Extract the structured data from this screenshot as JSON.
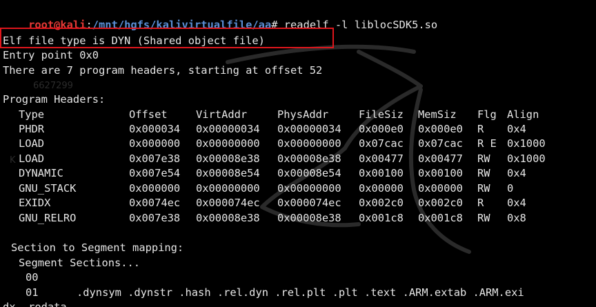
{
  "prompt": {
    "user_host": "root@kali",
    "separator": ":",
    "path": "/mnt/hgfs/kalivirtualfile/aa",
    "symbol": "#",
    "command": " readelf -l liblocSDK5.so"
  },
  "header": {
    "file_type": "Elf file type is DYN (Shared object file)",
    "entry_point": "Entry point 0x0",
    "program_headers_count": "There are 7 program headers, starting at offset 52"
  },
  "program_headers": {
    "title": "Program Headers:",
    "columns": [
      "Type",
      "Offset",
      "VirtAddr",
      "PhysAddr",
      "FileSiz",
      "MemSiz",
      "Flg",
      "Align"
    ],
    "rows": [
      [
        "PHDR",
        "0x000034",
        "0x00000034",
        "0x00000034",
        "0x000e0",
        "0x000e0",
        "R",
        "0x4"
      ],
      [
        "LOAD",
        "0x000000",
        "0x00000000",
        "0x00000000",
        "0x07cac",
        "0x07cac",
        "R E",
        "0x1000"
      ],
      [
        "LOAD",
        "0x007e38",
        "0x00008e38",
        "0x00008e38",
        "0x00477",
        "0x00477",
        "RW",
        "0x1000"
      ],
      [
        "DYNAMIC",
        "0x007e54",
        "0x00008e54",
        "0x00008e54",
        "0x00100",
        "0x00100",
        "RW",
        "0x4"
      ],
      [
        "GNU_STACK",
        "0x000000",
        "0x00000000",
        "0x00000000",
        "0x00000",
        "0x00000",
        "RW",
        "0"
      ],
      [
        "EXIDX",
        "0x0074ec",
        "0x000074ec",
        "0x000074ec",
        "0x002c0",
        "0x002c0",
        "R",
        "0x4"
      ],
      [
        "GNU_RELRO",
        "0x007e38",
        "0x00008e38",
        "0x00008e38",
        "0x001c8",
        "0x001c8",
        "RW",
        "0x8"
      ]
    ]
  },
  "section_mapping": {
    "title": "Section to Segment mapping:",
    "subtitle": "Segment Sections...",
    "rows": [
      {
        "segment": "00",
        "sections": ""
      },
      {
        "segment": "01",
        "sections": ".dynsym .dynstr .hash .rel.dyn .rel.plt .plt .text .ARM.extab .ARM.exi"
      }
    ],
    "wrapped_tail": "dx .rodata"
  },
  "background_faint_text": {
    "a": "6627299",
    "b": "K"
  },
  "colors": {
    "background": "#000000",
    "text": "#e6e6e6",
    "user_host": "#e53935",
    "path": "#5b8fd6",
    "highlight_box": "#e0161c"
  }
}
